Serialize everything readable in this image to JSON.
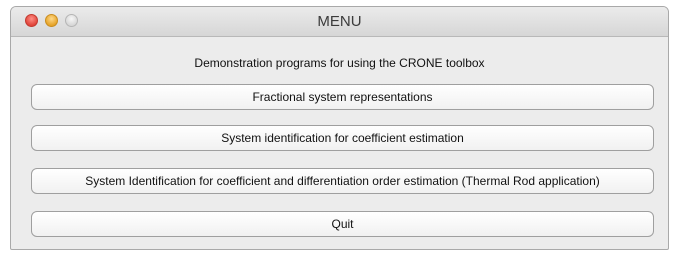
{
  "window": {
    "title": "MENU"
  },
  "main": {
    "subtitle": "Demonstration programs for using the CRONE toolbox",
    "buttons": [
      {
        "label": "Fractional system representations"
      },
      {
        "label": "System identification for coefficient estimation"
      },
      {
        "label": "System Identification for coefficient and differentiation order estimation (Thermal Rod application)"
      },
      {
        "label": "Quit"
      }
    ]
  },
  "colors": {
    "close": "#e0453b",
    "minimize": "#e6a42a",
    "zoom": "#d7d7d7",
    "window_bg": "#ececec"
  }
}
